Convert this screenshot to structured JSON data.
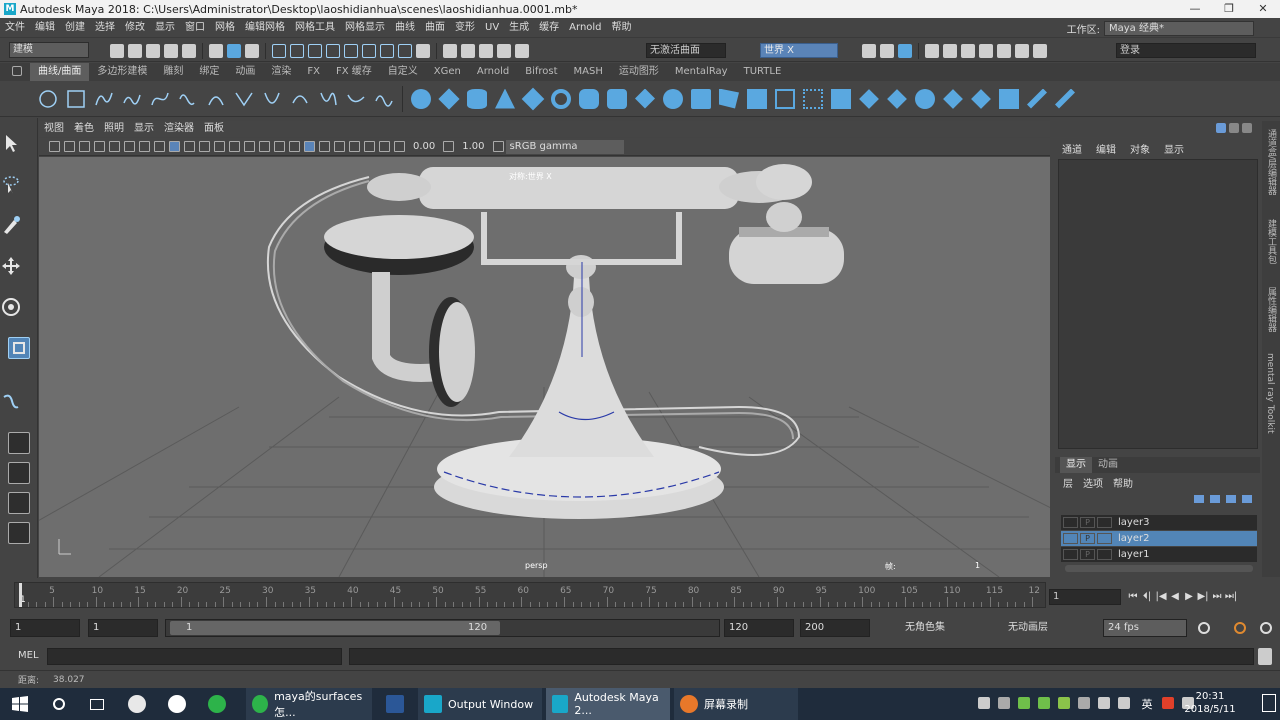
{
  "titlebar": {
    "title": "Autodesk Maya 2018: C:\\Users\\Administrator\\Desktop\\laoshidianhua\\scenes\\laoshidianhua.0001.mb*",
    "minimize": "—",
    "restore": "❐",
    "close": "✕"
  },
  "menu": [
    "文件",
    "编辑",
    "创建",
    "选择",
    "修改",
    "显示",
    "窗口",
    "网格",
    "编辑网格",
    "网格工具",
    "网格显示",
    "曲线",
    "曲面",
    "变形",
    "UV",
    "生成",
    "缓存",
    "Arnold",
    "帮助"
  ],
  "workspace": {
    "label": "工作区:",
    "value": "Maya 经典*"
  },
  "statusline": {
    "mode": "建模",
    "live_surface": "无激活曲面",
    "world": "世界 X",
    "login": "登录"
  },
  "shelf_tabs": [
    "曲线/曲面",
    "多边形建模",
    "雕刻",
    "绑定",
    "动画",
    "渲染",
    "FX",
    "FX 缓存",
    "自定义",
    "XGen",
    "Arnold",
    "Bifrost",
    "MASH",
    "运动图形",
    "MentalRay",
    "TURTLE"
  ],
  "shelf_active": 0,
  "viewport": {
    "menu": [
      "视图",
      "着色",
      "照明",
      "显示",
      "渲染器",
      "面板"
    ],
    "exposure": "0.00",
    "gamma": "1.00",
    "color_space": "sRGB gamma",
    "hud_label": "对称:世界 X",
    "camera": "persp",
    "frame_label": "帧:",
    "frame_value": "1"
  },
  "channel_box": {
    "menu": [
      "通道",
      "编辑",
      "对象",
      "显示"
    ]
  },
  "layer_editor": {
    "tabs": [
      "显示",
      "动画"
    ],
    "menu": [
      "层",
      "选项",
      "帮助"
    ],
    "layers": [
      {
        "name": "layer3",
        "selected": false,
        "p": "P"
      },
      {
        "name": "layer2",
        "selected": true,
        "p": "P"
      },
      {
        "name": "layer1",
        "selected": false,
        "p": "P"
      }
    ]
  },
  "side_tabs": [
    "通道盒/层编辑器",
    "建模工具包",
    "属性编辑器",
    "mental ray Toolkit"
  ],
  "timeline": {
    "ticks": [
      1,
      5,
      10,
      15,
      20,
      25,
      30,
      35,
      40,
      45,
      50,
      55,
      60,
      65,
      70,
      75,
      80,
      85,
      90,
      95,
      100,
      105,
      110,
      115,
      120
    ],
    "labels": [
      "5",
      "10",
      "15",
      "20",
      "25",
      "30",
      "35",
      "40",
      "45",
      "50",
      "55",
      "60",
      "65",
      "70",
      "75",
      "80",
      "85",
      "90",
      "95",
      "100",
      "105",
      "110",
      "115",
      "12"
    ],
    "start_label": "1",
    "current_frame": "1",
    "playback": [
      "⏮",
      "⏴|",
      "|◀",
      "◀",
      "▶",
      "▶|",
      "⏭",
      "⏭|"
    ]
  },
  "range": {
    "start": "1",
    "start2": "1",
    "slider_start": "1",
    "slider_end": "120",
    "end": "120",
    "end2": "200",
    "char_set": "无角色集",
    "anim_layer": "无动画层",
    "fps": "24 fps"
  },
  "mel": {
    "label": "MEL"
  },
  "help": {
    "text": "距离:",
    "value": "38.027"
  },
  "taskbar": {
    "items": [
      "maya的surfaces怎...",
      "Output Window",
      "Autodesk Maya 2...",
      "屏幕录制"
    ],
    "lang": "英",
    "time": "20:31",
    "date": "2018/5/11"
  },
  "colors": {
    "accent": "#5285b7",
    "maya_teal": "#19a7c9",
    "viewport_bg": "#6e6e6e"
  }
}
